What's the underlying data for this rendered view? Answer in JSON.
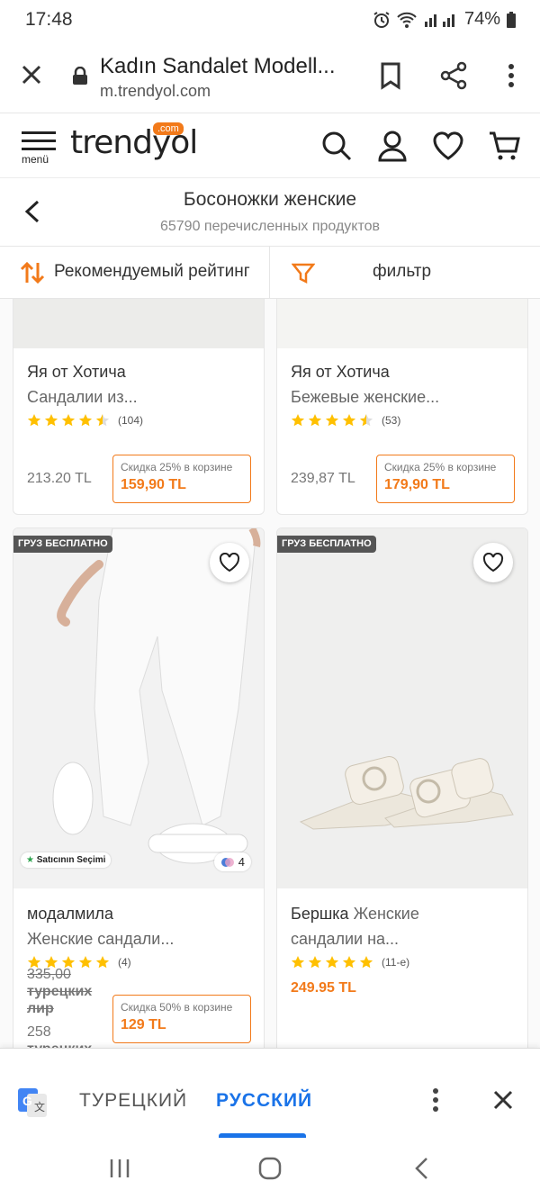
{
  "status": {
    "time": "17:48",
    "battery": "74%"
  },
  "browser": {
    "title": "Kadın Sandalet Modell...",
    "url": "m.trendyol.com"
  },
  "site": {
    "menu_label": "menü",
    "logo": "trendyol",
    "logo_badge": ".com"
  },
  "category": {
    "title": "Босоножки женские",
    "count": "65790 перечисленных продуктов"
  },
  "toolbar": {
    "sort_label": "Рекомендуемый рейтинг",
    "filter_label": "фильтр"
  },
  "products": [
    {
      "brand": "Яя от Хотича",
      "desc": "Сандалии из...",
      "rating": 4.5,
      "reviews": "(104)",
      "old_price": "213.20 TL",
      "discount_label": "Скидка",
      "discount_pct": "25%",
      "discount_suffix": "в корзине",
      "price": "159,90 TL"
    },
    {
      "brand": "Яя от Хотича",
      "desc": "Бежевые женские...",
      "rating": 4.5,
      "reviews": "(53)",
      "old_price": "239,87 TL",
      "discount_label": "Скидка",
      "discount_pct": "25%",
      "discount_suffix": "в корзине",
      "price": "179,90 TL"
    },
    {
      "badge": "ГРУЗ БЕСПЛАТНО",
      "seller_badge": "Satıcının Seçimi",
      "color_count": "4",
      "brand": "модалмила",
      "desc": "Женские сандали...",
      "rating": 5,
      "reviews": "(4)",
      "old_price_a": "335,00",
      "old_price_b": "турецких",
      "old_price_c": "лир",
      "old2_a": "258",
      "old2_b": "турецких",
      "discount_label": "Скидка",
      "discount_pct": "50%",
      "discount_suffix": "в корзине",
      "price": "129 TL"
    },
    {
      "badge": "ГРУЗ БЕСПЛАТНО",
      "brand": "Бершка",
      "desc_inline": "Женские",
      "desc": "сандалии на...",
      "rating": 5,
      "reviews": "(11-е)",
      "price": "249.95 TL"
    }
  ],
  "translate": {
    "from": "ТУРЕЦКИЙ",
    "to": "РУССКИЙ"
  },
  "colors": {
    "accent": "#f27a1a",
    "star": "#ffc000",
    "translate_blue": "#1a73e8"
  }
}
